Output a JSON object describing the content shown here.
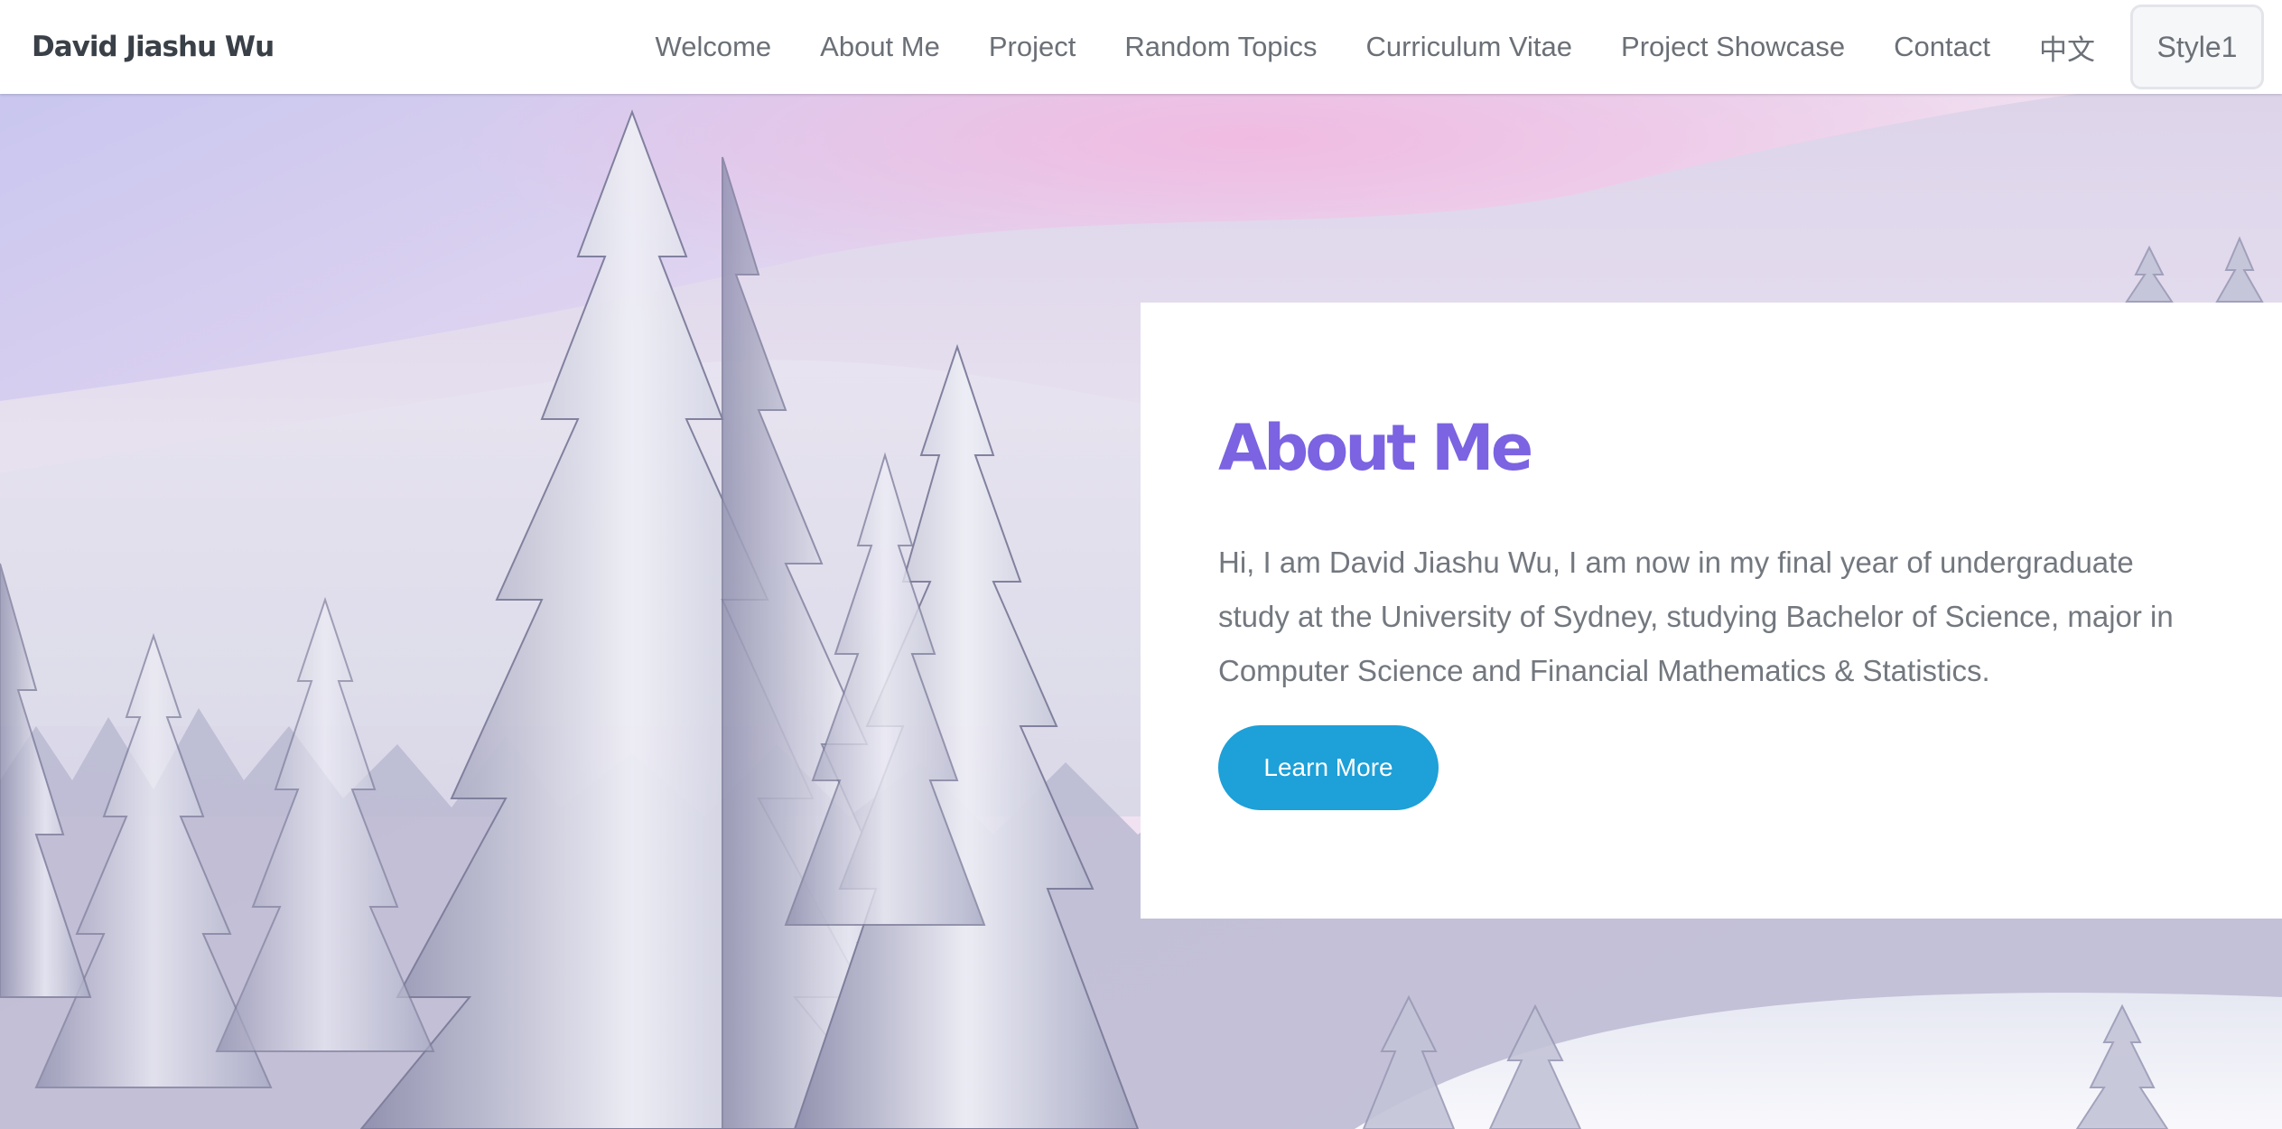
{
  "navbar": {
    "brand": "David Jiashu Wu",
    "links": [
      {
        "label": "Welcome"
      },
      {
        "label": "About Me"
      },
      {
        "label": "Project"
      },
      {
        "label": "Random Topics"
      },
      {
        "label": "Curriculum Vitae"
      },
      {
        "label": "Project Showcase"
      },
      {
        "label": "Contact"
      },
      {
        "label": "中文"
      }
    ],
    "style_button": "Style1"
  },
  "about": {
    "title": "About Me",
    "text": "Hi, I am David Jiashu Wu, I am now in my final year of undergraduate study at the University of Sydney, studying Bachelor of Science, major in Computer Science and Financial Mathematics & Statistics.",
    "button_label": "Learn More"
  },
  "colors": {
    "title_accent": "#7b63e2",
    "button_bg": "#1ea0d8",
    "body_text": "#73787f",
    "nav_text": "#6b7077"
  }
}
